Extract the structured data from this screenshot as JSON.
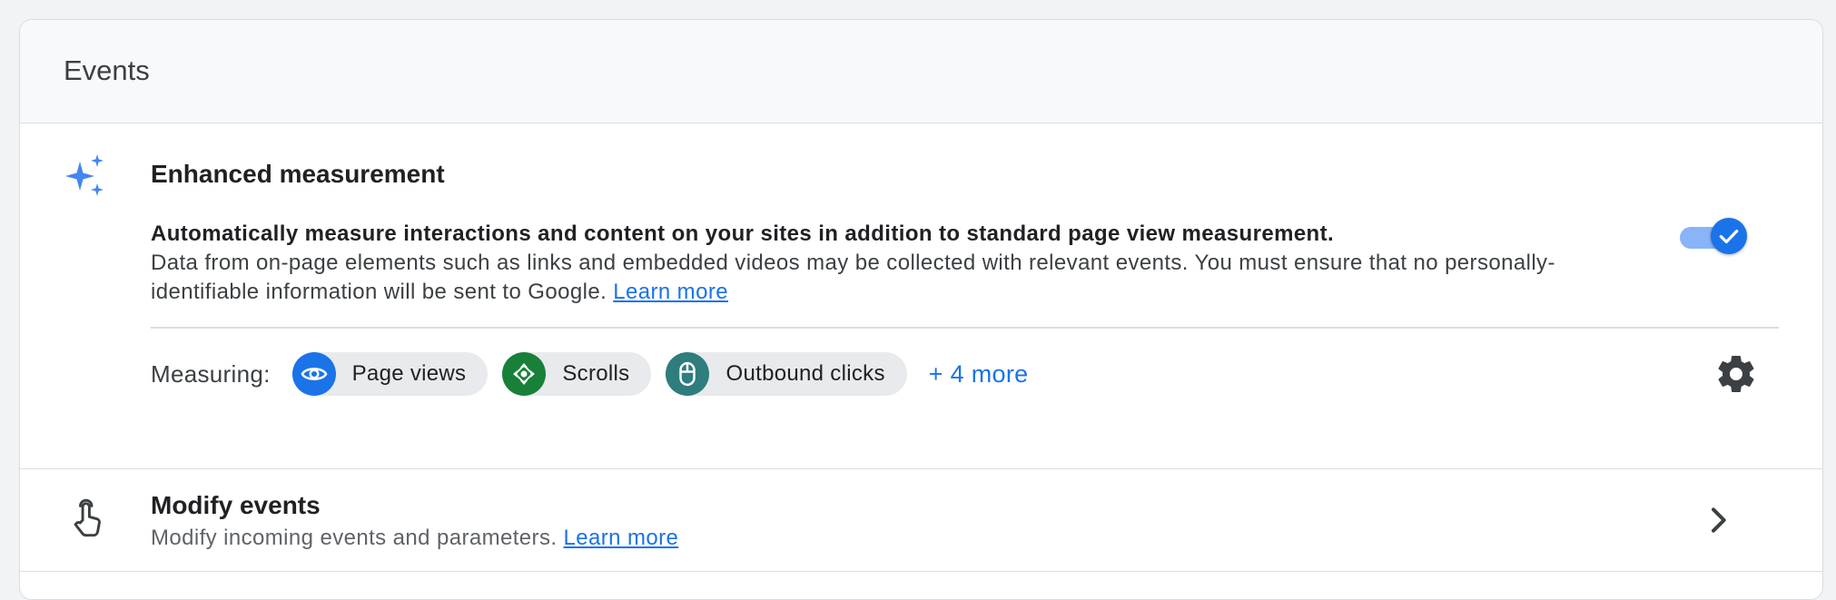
{
  "card": {
    "title": "Events"
  },
  "enhanced": {
    "title": "Enhanced measurement",
    "lead": "Automatically measure interactions and content on your sites in addition to standard page view measurement.",
    "detail": "Data from on-page elements such as links and embedded videos may be collected with relevant events. You must ensure that no personally-identifiable information will be sent to Google.",
    "learn_more": "Learn more",
    "toggle_on": true,
    "measuring_label": "Measuring:",
    "chips": [
      {
        "label": "Page views",
        "icon": "eye-icon",
        "color": "#1a73e8"
      },
      {
        "label": "Scrolls",
        "icon": "scroll-arrows-icon",
        "color": "#188038"
      },
      {
        "label": "Outbound clicks",
        "icon": "mouse-icon",
        "color": "#12808a"
      }
    ],
    "more": "+ 4 more"
  },
  "modify": {
    "title": "Modify events",
    "desc": "Modify incoming events and parameters.",
    "learn_more": "Learn more"
  },
  "colors": {
    "accent": "#1a73e8",
    "toggle_track": "#8ab4f8",
    "border": "#dadce0"
  }
}
